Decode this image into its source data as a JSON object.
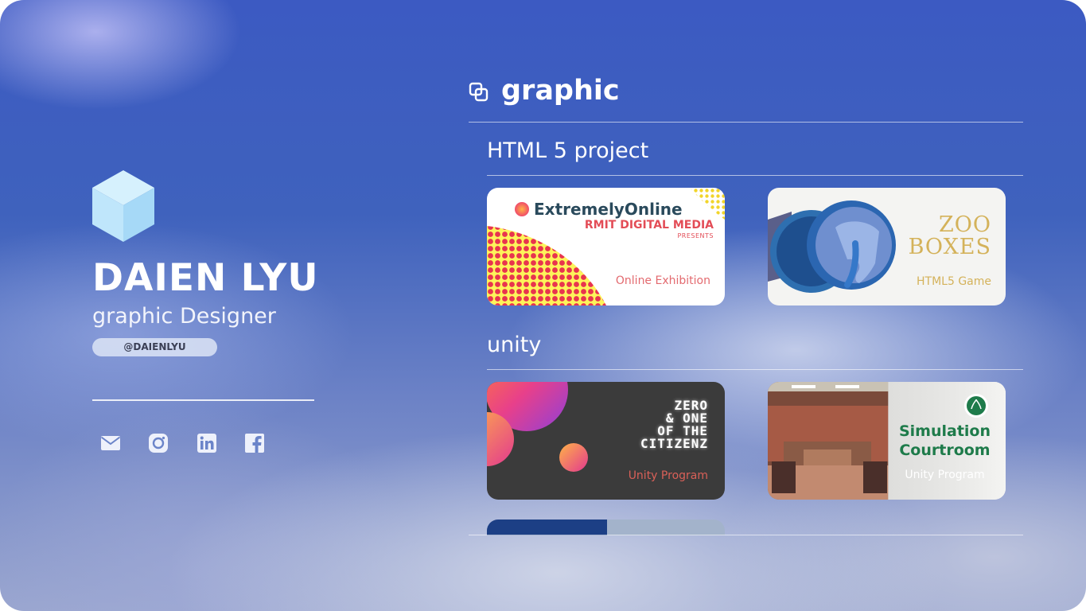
{
  "profile": {
    "name": "DAIEN LYU",
    "role": "graphic Designer",
    "handle": "@DAIENLYU",
    "social_icons": [
      "mail-icon",
      "instagram-icon",
      "linkedin-icon",
      "facebook-icon"
    ]
  },
  "section": {
    "icon": "layers-icon",
    "title": "graphic"
  },
  "groups": [
    {
      "title": "HTML 5 project",
      "cards": [
        {
          "title": "ExtremelyOnline",
          "line2": "RMIT DIGITAL MEDIA",
          "line3": "PRESENTS",
          "subtitle": "Online Exhibition"
        },
        {
          "title": "ZOO BOXES",
          "subtitle": "HTML5 Game"
        }
      ]
    },
    {
      "title": "unity",
      "cards": [
        {
          "title": "ZERO\n& ONE\nOF THE\nCITIZENZ",
          "subtitle": "Unity Program"
        },
        {
          "title": "Simulation Courtroom",
          "subtitle": "Unity Program"
        }
      ]
    }
  ],
  "colors": {
    "accent_red": "#e34d57",
    "gold": "#d4b25a",
    "green": "#1e7b4a",
    "cube": "#bfe6fb"
  }
}
